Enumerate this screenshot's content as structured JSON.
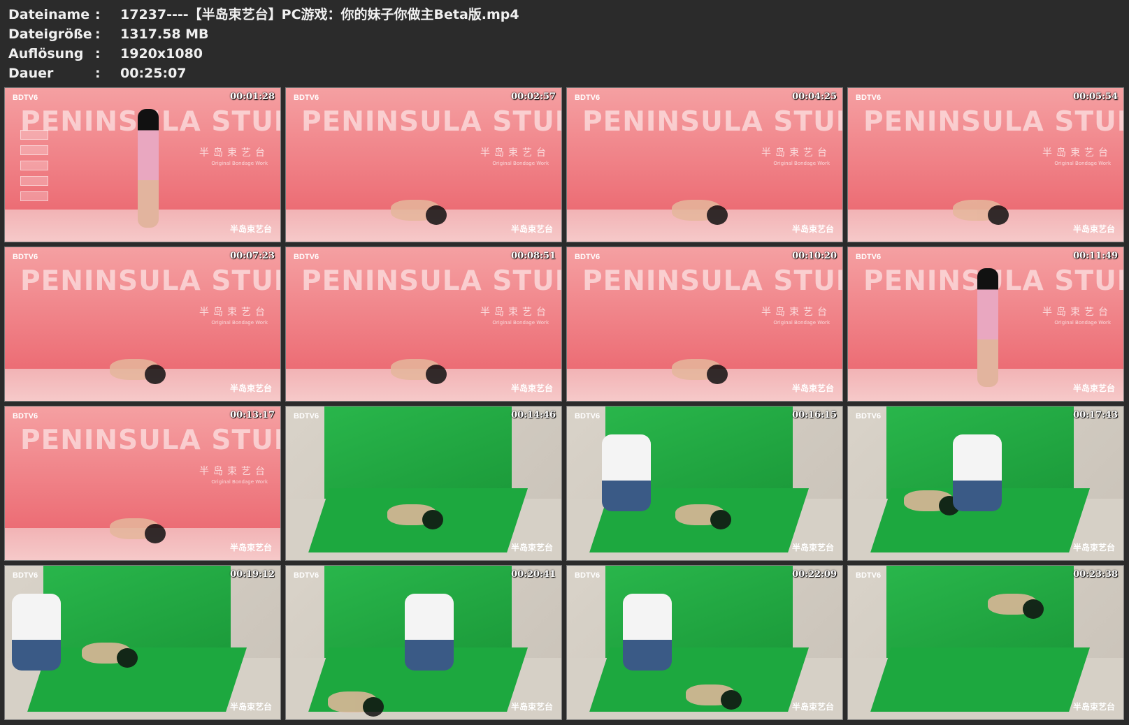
{
  "info": {
    "filename": {
      "label": "Dateiname",
      "value": "17237----【半岛束艺台】PC游戏：你的妹子你做主Beta版.mp4"
    },
    "filesize": {
      "label": "Dateigröße",
      "value": "1317.58 MB"
    },
    "resolution": {
      "label": "Auflösung",
      "value": "1920x1080"
    },
    "duration": {
      "label": "Dauer",
      "value": "00:25:07"
    },
    "separator": ":"
  },
  "thumbnails": [
    {
      "timestamp": "00:01:28",
      "scene": "pink"
    },
    {
      "timestamp": "00:02:57",
      "scene": "pink"
    },
    {
      "timestamp": "00:04:25",
      "scene": "pink"
    },
    {
      "timestamp": "00:05:54",
      "scene": "pink"
    },
    {
      "timestamp": "00:07:23",
      "scene": "pink"
    },
    {
      "timestamp": "00:08:51",
      "scene": "pink"
    },
    {
      "timestamp": "00:10:20",
      "scene": "pink"
    },
    {
      "timestamp": "00:11:49",
      "scene": "pink"
    },
    {
      "timestamp": "00:13:17",
      "scene": "pink"
    },
    {
      "timestamp": "00:14:46",
      "scene": "green"
    },
    {
      "timestamp": "00:16:15",
      "scene": "green"
    },
    {
      "timestamp": "00:17:43",
      "scene": "green"
    },
    {
      "timestamp": "00:19:12",
      "scene": "green"
    },
    {
      "timestamp": "00:20:41",
      "scene": "green"
    },
    {
      "timestamp": "00:22:09",
      "scene": "green"
    },
    {
      "timestamp": "00:23:38",
      "scene": "green"
    }
  ],
  "watermark": "BDTV6",
  "studio": {
    "name": "PENINSULA STUDIO",
    "name_cn": "半岛束艺台",
    "tagline": "Original Bondage Work"
  },
  "logo_text": "半岛束艺台",
  "colors": {
    "background": "#2b2b2b",
    "text": "#f0f0f0",
    "pink": "#ec6c74",
    "green": "#1da83f"
  }
}
